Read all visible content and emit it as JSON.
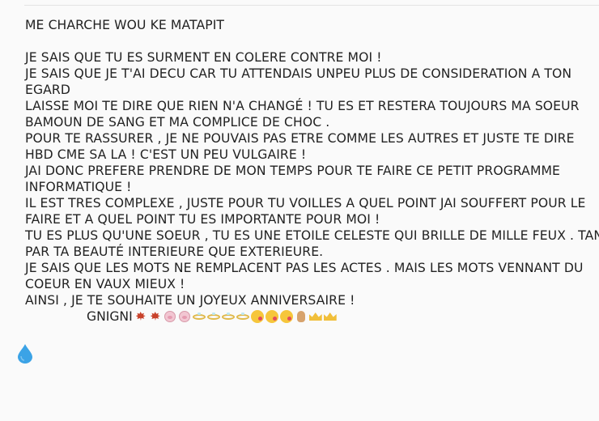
{
  "message": {
    "lines": [
      "ME CHARCHE WOU KE MATAPIT",
      "",
      "JE SAIS QUE TU ES SURMENT EN COLERE CONTRE MOI !",
      "JE SAIS QUE JE T'AI DECU CAR TU ATTENDAIS UNPEU PLUS DE CONSIDERATION A TON",
      "EGARD",
      "LAISSE MOI TE DIRE QUE RIEN N'A CHANGÉ ! TU ES ET RESTERA TOUJOURS MA SOEUR",
      "BAMOUN DE SANG ET MA COMPLICE DE CHOC .",
      "POUR TE RASSURER , JE NE POUVAIS PAS ETRE COMME LES AUTRES ET JUSTE TE DIRE",
      "HBD CME SA LA ! C'EST UN PEU VULGAIRE !",
      "JAI DONC PREFERE PRENDRE DE MON TEMPS POUR TE FAIRE CE PETIT PROGRAMME",
      "INFORMATIQUE !",
      "IL EST TRES COMPLEXE , JUSTE POUR TU VOILLES A QUEL POINT JAI SOUFFERT POUR LE",
      "FAIRE ET A QUEL POINT TU ES IMPORTANTE POUR MOI !",
      "TU ES PLUS QU'UNE SOEUR , TU ES UNE ETOILE CELESTE QUI BRILLE DE MILLE FEUX . TANT",
      "PAR TA BEAUTÉ INTERIEURE QUE EXTERIEURE.",
      "JE SAIS QUE LES MOTS NE REMPLACENT PAS LES ACTES . MAIS LES MOTS VENNANT DU",
      "COEUR EN VAUX MIEUX !",
      "AINSI , JE TE SOUHAITE UN JOYEUX ANNIVERSAIRE !"
    ],
    "signature": "GNIGNI",
    "signature_emojis": [
      "maple-leaf",
      "maple-leaf",
      "pig-face",
      "pig-face",
      "ring",
      "ring",
      "ring",
      "ring",
      "kissing-face",
      "kissing-face",
      "kissing-face",
      "hand",
      "crown",
      "crown"
    ]
  },
  "colors": {
    "text": "#222222",
    "background": "#fafafa",
    "drop_icon": "#3ba3e6"
  },
  "icons": {
    "drop_button": "water-drop-icon"
  }
}
